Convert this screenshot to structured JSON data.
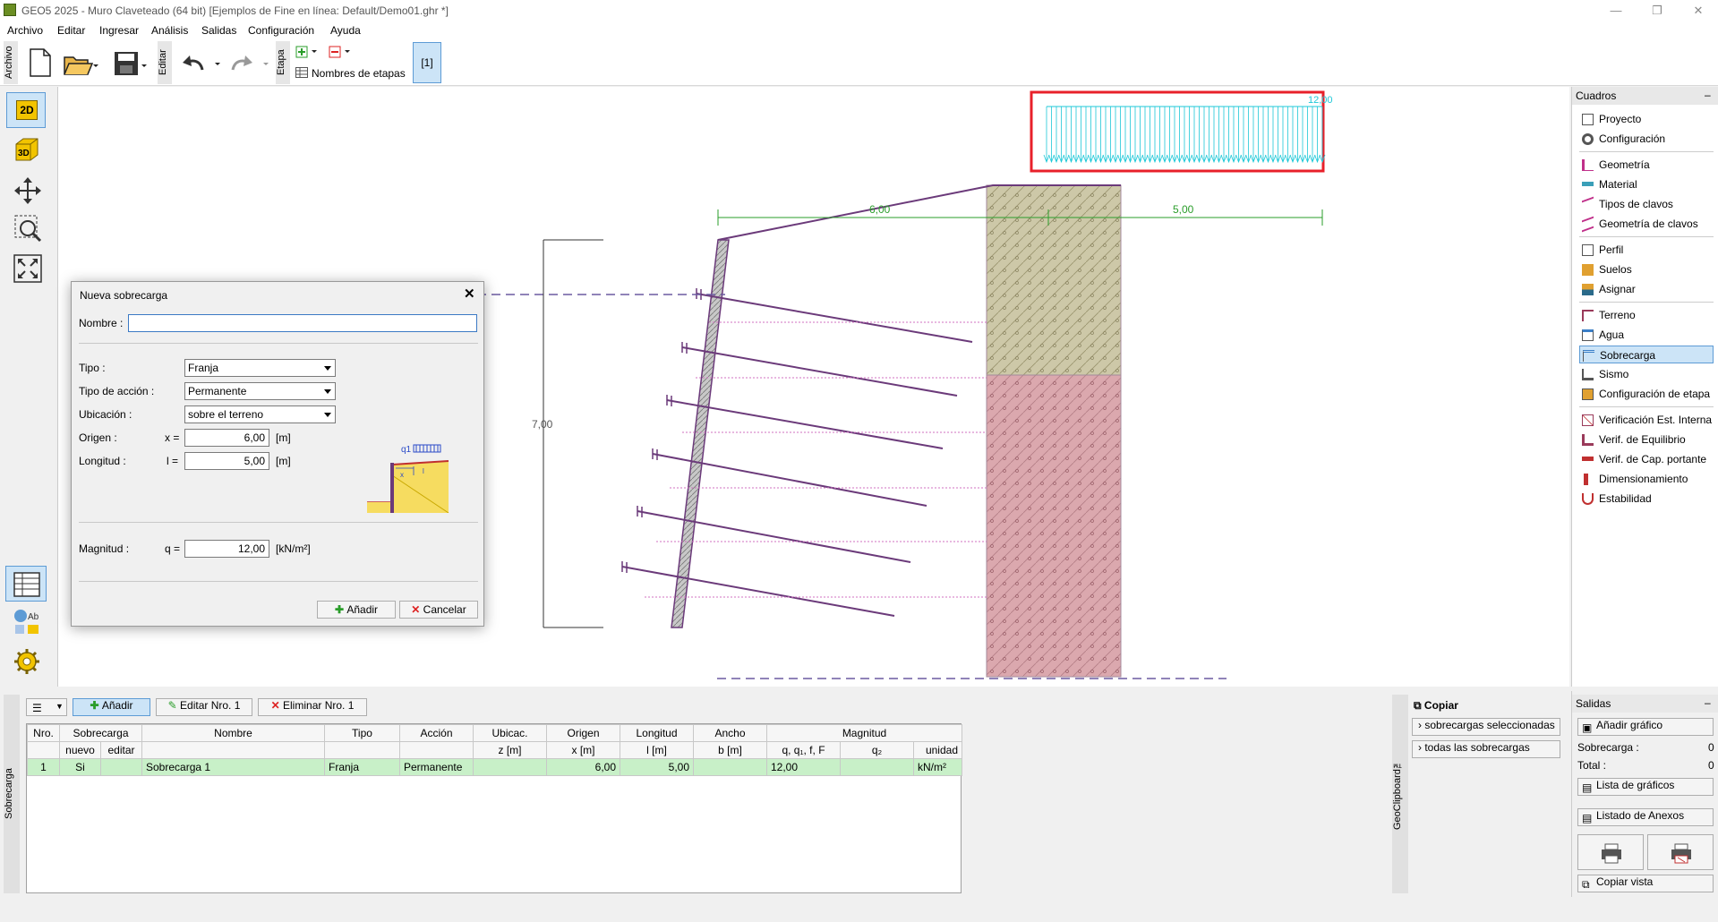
{
  "window": {
    "title": "GEO5 2025 - Muro Claveteado (64 bit) [Ejemplos de Fine en línea: Default/Demo01.ghr *]",
    "controls": [
      "—",
      "❐",
      "✕"
    ]
  },
  "menu": [
    "Archivo",
    "Editar",
    "Ingresar",
    "Análisis",
    "Salidas",
    "Configuración",
    "Ayuda"
  ],
  "toolbar": {
    "archivo_label": "Archivo",
    "editar_label": "Editar",
    "etapa_label": "Etapa",
    "stage_names_label": "Nombres de etapas",
    "stage_button": "[1]"
  },
  "left_tools": {
    "btn_2d": "2D",
    "btn_3d": "3D"
  },
  "canvas": {
    "surcharge_label": "12,00",
    "dim_left": "6,00",
    "dim_right": "5,00",
    "height_label": "7,00",
    "accent_color": "#e8202a"
  },
  "right_panel": {
    "header": "Cuadros",
    "collapse": "–",
    "groups": [
      [
        "Proyecto",
        "Configuración"
      ],
      [
        "Geometría",
        "Material",
        "Tipos de clavos",
        "Geometría de clavos"
      ],
      [
        "Perfil",
        "Suelos",
        "Asignar"
      ],
      [
        "Terreno",
        "Agua",
        "Sobrecarga",
        "Sismo",
        "Configuración de etapa"
      ],
      [
        "Verificación Est. Interna",
        "Verif. de Equilibrio",
        "Verif. de Cap. portante",
        "Dimensionamiento",
        "Estabilidad"
      ]
    ],
    "selected": "Sobrecarga"
  },
  "dialog": {
    "title": "Nueva sobrecarga",
    "close": "✕",
    "nombre_label": "Nombre :",
    "nombre_value": "",
    "tipo_label": "Tipo :",
    "tipo_value": "Franja",
    "accion_label": "Tipo de acción :",
    "accion_value": "Permanente",
    "ubicacion_label": "Ubicación :",
    "ubicacion_value": "sobre el terreno",
    "origen_label": "Origen :",
    "origen_var": "x =",
    "origen_value": "6,00",
    "origen_unit": "[m]",
    "longitud_label": "Longitud :",
    "longitud_var": "l =",
    "longitud_value": "5,00",
    "longitud_unit": "[m]",
    "magnitud_label": "Magnitud :",
    "magnitud_var": "q =",
    "magnitud_value": "12,00",
    "magnitud_unit": "[kN/m²]",
    "sketch_q": "q1",
    "sketch_x": "x",
    "sketch_l": "l",
    "add_button": "Añadir",
    "cancel_button": "Cancelar"
  },
  "bottom": {
    "side_label": "Sobrecarga",
    "add_button": "Añadir",
    "edit_button": "Editar Nro. 1",
    "delete_button": "Eliminar Nro. 1",
    "headers_top": [
      "Nro.",
      "Sobrecarga",
      "Nombre",
      "Tipo",
      "Acción",
      "Ubicac.",
      "Origen",
      "Longitud",
      "Ancho",
      "Magnitud"
    ],
    "headers_sub": [
      "",
      "nuevo",
      "editar",
      "",
      "",
      "",
      "z [m]",
      "x [m]",
      "l [m]",
      "b [m]",
      "q, q₁, f, F",
      "q₂",
      "unidad"
    ],
    "rows": [
      [
        "1",
        "Si",
        "",
        "Sobrecarga 1",
        "Franja",
        "Permanente",
        "",
        "6,00",
        "5,00",
        "",
        "12,00",
        "",
        "kN/m²"
      ]
    ]
  },
  "clipboard": {
    "side_label": "GeoClipboard™",
    "copy_label": "Copiar",
    "opt1": "sobrecargas seleccionadas",
    "opt2": "todas las sobrecargas"
  },
  "salidas": {
    "header": "Salidas",
    "collapse": "–",
    "add_graph": "Añadir gráfico",
    "sobrecarga_label": "Sobrecarga :",
    "sobrecarga_value": "0",
    "total_label": "Total :",
    "total_value": "0",
    "graph_list": "Lista de gráficos",
    "annex_list": "Listado de Anexos",
    "copy_view": "Copiar vista"
  }
}
